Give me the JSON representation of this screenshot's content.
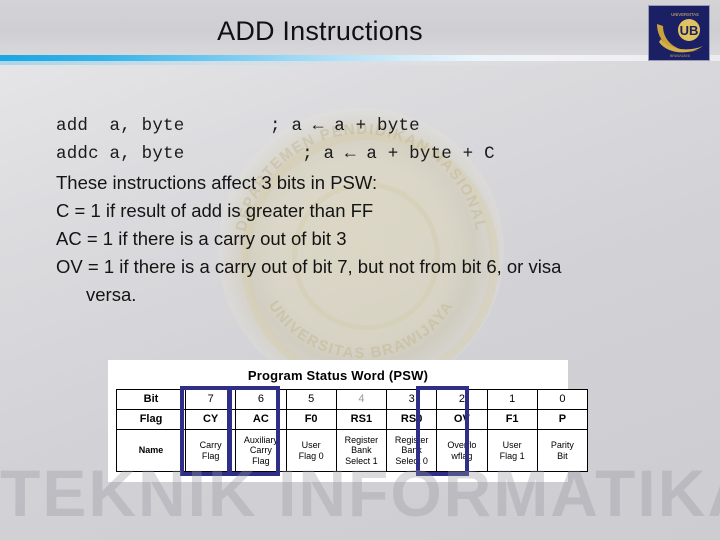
{
  "slide": {
    "title": "ADD Instructions",
    "logo_alt": "ub-university-logo",
    "watermark_bottom": "TEKNIK INFORMATIKA",
    "watermark_seal_top": "DEPARTEMEN PENDIDIKAN NASIONAL",
    "watermark_seal_bottom": "UNIVERSITAS BRAWIJAYA",
    "accent_color": "#1ba6e2",
    "highlight_color": "#2f2f87"
  },
  "content": {
    "code_lines": [
      "add  a, byte        ; a ← a + byte",
      "addc a, byte           ; a ← a + byte + C"
    ],
    "body_lines": [
      "These instructions affect 3 bits in PSW:",
      "C = 1 if result of add is greater than FF",
      "AC = 1 if there is a carry out of bit 3"
    ],
    "body_last": {
      "line1": "OV = 1 if there is a carry out of bit 7, but not from bit 6, or visa",
      "line2": "versa."
    }
  },
  "psw": {
    "title": "Program Status Word (PSW)",
    "row_labels": [
      "Bit",
      "Flag",
      "Name"
    ],
    "columns": [
      {
        "bit": "7",
        "flag": "CY",
        "name": "Carry\nFlag",
        "highlight": true
      },
      {
        "bit": "6",
        "flag": "AC",
        "name": "Auxiliary\nCarry\nFlag",
        "highlight": true
      },
      {
        "bit": "5",
        "flag": "F0",
        "name": "User\nFlag 0",
        "highlight": false
      },
      {
        "bit": "4",
        "flag": "RS1",
        "name": "Register\nBank\nSelect 1",
        "highlight": false,
        "faded": true
      },
      {
        "bit": "3",
        "flag": "RS0",
        "name": "Register\nBank\nSelect 0",
        "highlight": false
      },
      {
        "bit": "2",
        "flag": "OV",
        "name": "Overflo\nwflag",
        "highlight": true
      },
      {
        "bit": "1",
        "flag": "F1",
        "name": "User\nFlag 1",
        "highlight": false
      },
      {
        "bit": "0",
        "flag": "P",
        "name": "Parity\nBit",
        "highlight": false
      }
    ]
  }
}
